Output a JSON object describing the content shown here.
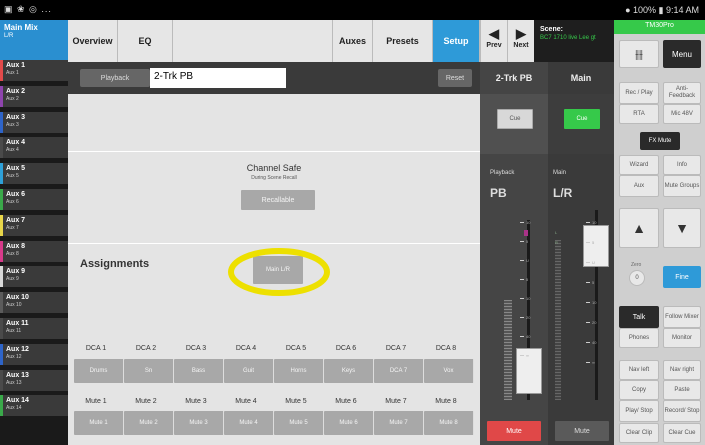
{
  "status_bar": {
    "left_icons": "▣ ❀ ◎ ...",
    "right": "● 100% ▮ 9:14 AM"
  },
  "sidebar": {
    "mix": {
      "title": "Main Mix",
      "sub": "L/R"
    },
    "items": [
      {
        "label": "Aux 1",
        "sub": "Aux 1",
        "color": "#e24a4a"
      },
      {
        "label": "Aux 2",
        "sub": "Aux 2",
        "color": "#8e44ad"
      },
      {
        "label": "Aux 3",
        "sub": "Aux 3",
        "color": "#2e64c8"
      },
      {
        "label": "Aux 4",
        "sub": "Aux 4",
        "color": "#4a4a4a"
      },
      {
        "label": "Aux 5",
        "sub": "Aux 5",
        "color": "#2ea0d8"
      },
      {
        "label": "Aux 6",
        "sub": "Aux 6",
        "color": "#3aa94a"
      },
      {
        "label": "Aux 7",
        "sub": "Aux 7",
        "color": "#e8d64a"
      },
      {
        "label": "Aux 8",
        "sub": "Aux 8",
        "color": "#d83a8a"
      },
      {
        "label": "Aux 9",
        "sub": "Aux 9",
        "color": "#d8d8d8"
      },
      {
        "label": "Aux 10",
        "sub": "Aux 10",
        "color": "#5b5b5b"
      },
      {
        "label": "Aux 11",
        "sub": "Aux 11",
        "color": "#4a4a4a"
      },
      {
        "label": "Aux 12",
        "sub": "Aux 12",
        "color": "#2e64c8"
      },
      {
        "label": "Aux 13",
        "sub": "Aux 13",
        "color": "#4a4a4a"
      },
      {
        "label": "Aux 14",
        "sub": "Aux 14",
        "color": "#3aa94a"
      }
    ]
  },
  "tabs": {
    "overview": "Overview",
    "eq": "EQ",
    "auxes": "Auxes",
    "presets": "Presets",
    "setup": "Setup"
  },
  "nav": {
    "prev": "Prev",
    "next": "Next"
  },
  "scene": {
    "label": "Scene:",
    "value": "BC7 1710 live Lee gt"
  },
  "playback_row": {
    "playback_btn": "Playback",
    "name": "2-Trk PB",
    "reset": "Reset"
  },
  "channel_safe": {
    "title": "Channel Safe",
    "subtitle": "During Scene Recall",
    "button": "Recallable"
  },
  "assignments": {
    "title": "Assignments",
    "main_lr": "Main L/R",
    "dca_labels": [
      "DCA 1",
      "DCA 2",
      "DCA 3",
      "DCA 4",
      "DCA 5",
      "DCA 6",
      "DCA 7",
      "DCA 8"
    ],
    "dca_buttons": [
      "Drums",
      "Sn",
      "Bass",
      "Guit",
      "Horns",
      "Keys",
      "DCA 7",
      "Vox"
    ],
    "mute_labels": [
      "Mute 1",
      "Mute 2",
      "Mute 3",
      "Mute 4",
      "Mute 5",
      "Mute 6",
      "Mute 7",
      "Mute 8"
    ],
    "mute_buttons": [
      "Mute 1",
      "Mute 2",
      "Mute 3",
      "Mute 4",
      "Mute 5",
      "Mute 6",
      "Mute 7",
      "Mute 8"
    ]
  },
  "strips": {
    "left": {
      "header": "2-Trk PB",
      "cue": "Cue",
      "name_label": "Playback",
      "name": "PB",
      "mute": "Mute"
    },
    "right": {
      "header": "Main",
      "cue": "Cue",
      "name_label": "Main",
      "name": "L/R",
      "mute": "Mute"
    },
    "scale": [
      "10",
      "5",
      "U",
      "5",
      "10",
      "20",
      "40",
      "∞"
    ],
    "meter_l": "L",
    "meter_r": "R"
  },
  "right_panel": {
    "model": "TM30Pro",
    "menu": "Menu",
    "icon": "mixer-icon",
    "rec_play": "Rec / Play",
    "anti_feedback": "Anti-Feedback",
    "rta": "RTA",
    "mic48": "Mic 48V",
    "fx_mute": "FX Mute",
    "wizard": "Wizard",
    "info": "Info",
    "aux": "Aux",
    "mute_groups": "Mute Groups",
    "zero_label": "Zero",
    "zero_value": "0",
    "fine": "Fine",
    "talk": "Talk",
    "follow_mixer": "Follow Mixer",
    "phones": "Phones",
    "monitor": "Monitor",
    "nav_left": "Nav left",
    "nav_right": "Nav right",
    "copy": "Copy",
    "paste": "Paste",
    "play_stop": "Play/ Stop",
    "record_stop": "Record/ Stop",
    "clear_clip": "Clear Clip",
    "clear_cue": "Clear Cue"
  },
  "colors": {
    "accent": "#2e9ad8",
    "green": "#36c94a",
    "mute_red": "#e04848",
    "highlight": "#ede000"
  }
}
